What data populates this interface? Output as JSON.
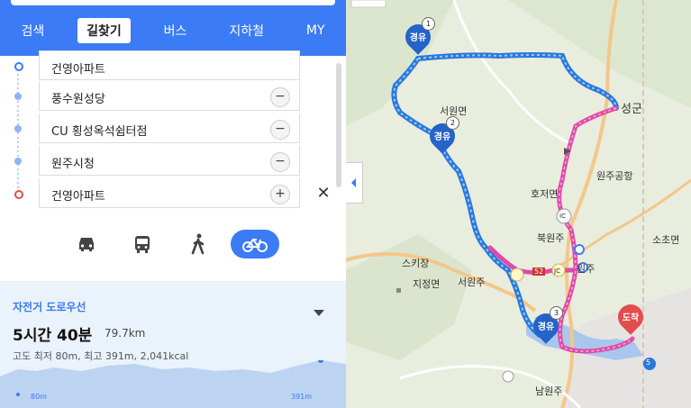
{
  "nav": {
    "tabs": [
      "검색",
      "길찾기",
      "버스",
      "지하철",
      "MY"
    ],
    "active": "길찾기"
  },
  "waypoints": [
    {
      "label": "건영아파트",
      "role": "start",
      "button": ""
    },
    {
      "label": "풍수원성당",
      "role": "via",
      "button": "−"
    },
    {
      "label": "CU 횡성옥석쉼터점",
      "role": "via",
      "button": "−"
    },
    {
      "label": "원주시청",
      "role": "via",
      "button": "−"
    },
    {
      "label": "건영아파트",
      "role": "end",
      "button": "+"
    }
  ],
  "close_label": "✕",
  "modes": [
    "car-icon",
    "bus-icon",
    "walk-icon",
    "bike-icon"
  ],
  "summary": {
    "route_type": "자전거 도로우선",
    "time": "5시간 40분",
    "distance": "79.7km",
    "elevation": "고도 최저 80m, 최고 391m",
    "kcal": "2,041kcal",
    "min_label": "80m",
    "max_label": "391m"
  },
  "map": {
    "labels": [
      "서원면",
      "성군",
      "원주공항",
      "호저면",
      "북원주",
      "스키장",
      "지정면",
      "서원주",
      "원주",
      "소초면",
      "남원주",
      "5",
      "52",
      "IC",
      "JC"
    ],
    "pins": [
      {
        "text": "경유",
        "num": "1"
      },
      {
        "text": "경유",
        "num": "2"
      },
      {
        "text": "경유",
        "num": "3"
      },
      {
        "text": "도착",
        "num": ""
      }
    ]
  },
  "colors": {
    "accent": "#3b7bf5",
    "route_blue": "#3b8de6",
    "route_pink": "#e04aa8"
  }
}
